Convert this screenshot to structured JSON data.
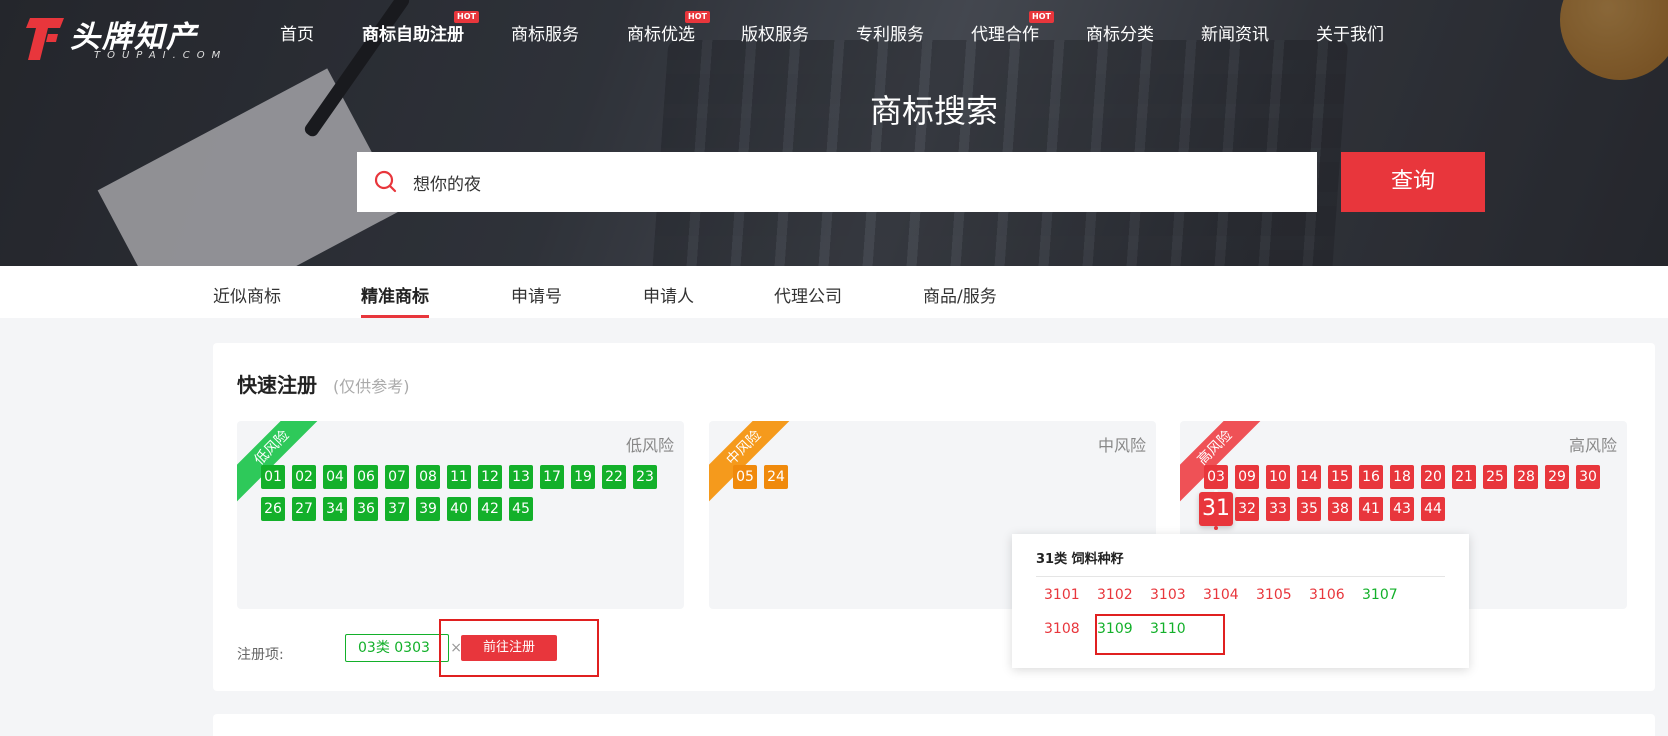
{
  "header": {
    "logo_text": "头牌知产",
    "logo_sub": "TOUPAI.COM",
    "nav": [
      {
        "label": "首页",
        "hot": false,
        "active": false
      },
      {
        "label": "商标自助注册",
        "hot": true,
        "active": true
      },
      {
        "label": "商标服务",
        "hot": false,
        "active": false
      },
      {
        "label": "商标优选",
        "hot": true,
        "active": false
      },
      {
        "label": "版权服务",
        "hot": false,
        "active": false
      },
      {
        "label": "专利服务",
        "hot": false,
        "active": false
      },
      {
        "label": "代理合作",
        "hot": true,
        "active": false
      },
      {
        "label": "商标分类",
        "hot": false,
        "active": false
      },
      {
        "label": "新闻资讯",
        "hot": false,
        "active": false
      },
      {
        "label": "关于我们",
        "hot": false,
        "active": false
      }
    ],
    "hot_label": "HOT"
  },
  "search": {
    "title": "商标搜索",
    "value": "想你的夜",
    "button": "查询"
  },
  "tabs": [
    {
      "label": "近似商标"
    },
    {
      "label": "精准商标"
    },
    {
      "label": "申请号"
    },
    {
      "label": "申请人"
    },
    {
      "label": "代理公司"
    },
    {
      "label": "商品/服务"
    }
  ],
  "quick": {
    "title": "快速注册",
    "note": "(仅供参考)",
    "panels": [
      {
        "ribbon": "低风险",
        "label": "低风险",
        "color": "#13b02a",
        "codes": [
          "01",
          "02",
          "04",
          "06",
          "07",
          "08",
          "11",
          "12",
          "13",
          "17",
          "19",
          "22",
          "23",
          "26",
          "27",
          "34",
          "36",
          "37",
          "39",
          "40",
          "42",
          "45"
        ]
      },
      {
        "ribbon": "中风险",
        "label": "中风险",
        "color": "#f08a0c",
        "codes": [
          "05",
          "24"
        ]
      },
      {
        "ribbon": "高风险",
        "label": "高风险",
        "color": "#e8363c",
        "codes": [
          "03",
          "09",
          "10",
          "14",
          "15",
          "16",
          "18",
          "20",
          "21",
          "25",
          "28",
          "29",
          "30",
          "31",
          "32",
          "33",
          "35",
          "38",
          "41",
          "43",
          "44"
        ]
      }
    ],
    "reg_label": "注册项:",
    "reg_tag": "03类 0303",
    "reg_tag_close": "×",
    "reg_button": "前往注册"
  },
  "popup": {
    "title": "31类 饲料种籽",
    "codes": [
      {
        "code": "3101",
        "status": "red"
      },
      {
        "code": "3102",
        "status": "red"
      },
      {
        "code": "3103",
        "status": "red"
      },
      {
        "code": "3104",
        "status": "red"
      },
      {
        "code": "3105",
        "status": "red"
      },
      {
        "code": "3106",
        "status": "red"
      },
      {
        "code": "3107",
        "status": "green"
      },
      {
        "code": "3108",
        "status": "red"
      },
      {
        "code": "3109",
        "status": "green"
      },
      {
        "code": "3110",
        "status": "green"
      }
    ]
  }
}
